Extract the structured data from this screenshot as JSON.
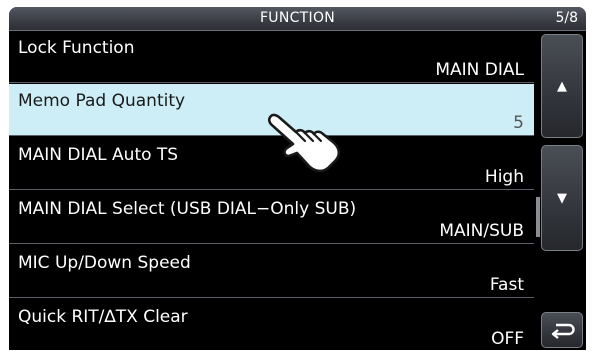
{
  "title_bar": {
    "title": "FUNCTION",
    "page_indicator": "5/8"
  },
  "menu": {
    "items": [
      {
        "label": "Lock Function",
        "value": "MAIN DIAL",
        "selected": false
      },
      {
        "label": "Memo Pad Quantity",
        "value": "5",
        "selected": true
      },
      {
        "label": "MAIN DIAL Auto TS",
        "value": "High",
        "selected": false
      },
      {
        "label": "MAIN DIAL Select (USB DIAL−Only SUB)",
        "value": "MAIN/SUB",
        "selected": false
      },
      {
        "label": "MIC Up/Down Speed",
        "value": "Fast",
        "selected": false
      },
      {
        "label": "Quick RIT/∆TX Clear",
        "value": "OFF",
        "selected": false
      }
    ]
  },
  "side_buttons": {
    "up_glyph": "▲",
    "down_glyph": "▼",
    "back_icon": "return-arrow-icon"
  },
  "colors": {
    "screen_bg": "#000000",
    "selected_row_bg": "#cdeef7",
    "divider": "#5b5f66",
    "title_bar": "#3a3d44"
  }
}
